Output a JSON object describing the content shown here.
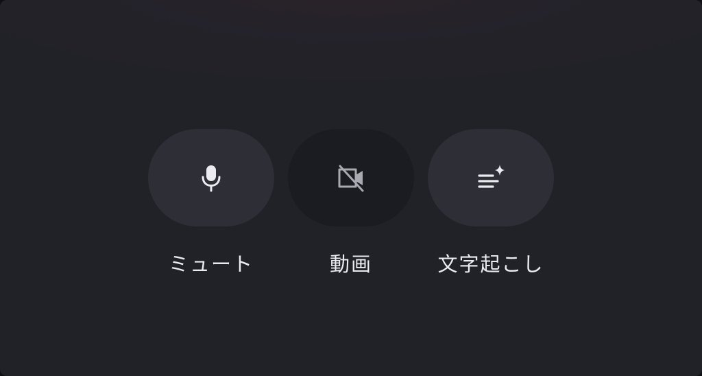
{
  "controls": {
    "mute": {
      "label": "ミュート",
      "icon": "microphone-icon"
    },
    "video": {
      "label": "動画",
      "icon": "video-off-icon",
      "state": "off"
    },
    "transcribe": {
      "label": "文字起こし",
      "icon": "transcript-sparkle-icon"
    }
  },
  "colors": {
    "background": "#212227",
    "button": "#2e2e36",
    "button_active_off": "#1b1c22",
    "icon": "#ececf0",
    "icon_dim": "#a9a9b1",
    "label": "#ececf0"
  }
}
